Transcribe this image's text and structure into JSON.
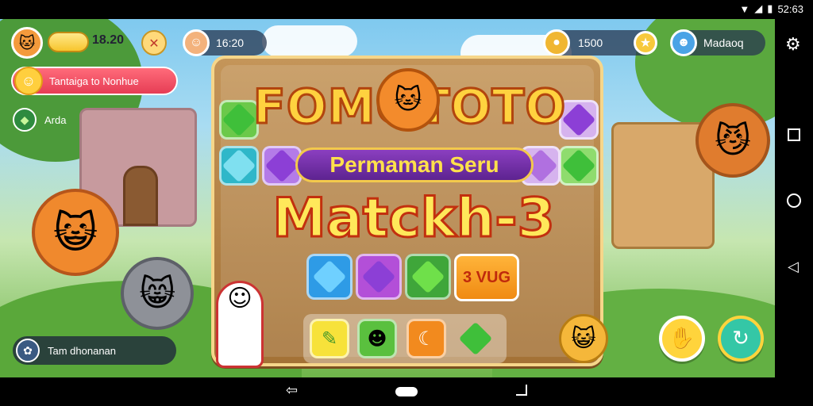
{
  "status_bar": {
    "time": "52:63"
  },
  "hud": {
    "player_score": "18.20",
    "timer": "16:20",
    "coins": "1500",
    "profile_name": "Madaoq"
  },
  "side_panel": {
    "quest_label": "Tantaiga to Nonhue",
    "aside_label": "Arda",
    "bottom_label": "Tam dhonanan"
  },
  "logo": {
    "title": "FOMOTOTO",
    "subtitle": "Permaman Seru",
    "match": "Matckh-3",
    "badge": "3 VUG"
  },
  "colors": {
    "gem_green": "#3fbf3a",
    "gem_purple": "#8c3fd6",
    "gem_blue": "#2e9be6",
    "tile_teal": "#2fb7c9",
    "title_yellow": "#ffd23f"
  },
  "icons": {
    "settings": "gear-icon",
    "recent_apps": "square-icon",
    "home": "circle-icon",
    "back": "triangle-back-icon",
    "nav_back": "arrow-left-icon",
    "nav_home": "pill-icon",
    "nav_recent": "corner-icon"
  }
}
